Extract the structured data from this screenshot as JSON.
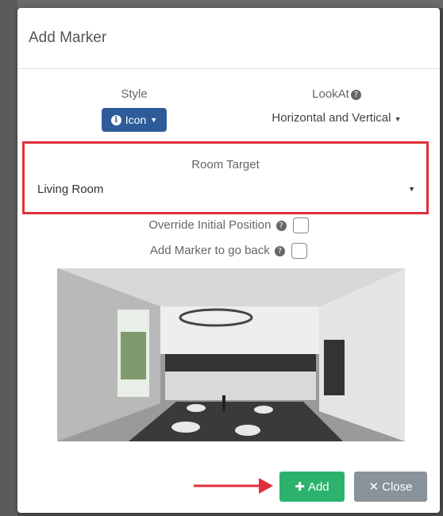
{
  "modal": {
    "title": "Add Marker",
    "style": {
      "label": "Style",
      "button_label": "Icon",
      "icon": "info-icon"
    },
    "lookat": {
      "label": "LookAt",
      "value": "Horizontal and Vertical"
    },
    "room_target": {
      "label": "Room Target",
      "value": "Living Room"
    },
    "override_initial_position": {
      "label": "Override Initial Position",
      "checked": false
    },
    "add_marker_go_back": {
      "label": "Add Marker to go back",
      "checked": false
    },
    "footer": {
      "add_label": "Add",
      "close_label": "Close"
    }
  },
  "colors": {
    "primary_button": "#2e5b99",
    "add_button": "#2cb26d",
    "close_button": "#8a929a",
    "highlight_box": "#e0303c"
  }
}
